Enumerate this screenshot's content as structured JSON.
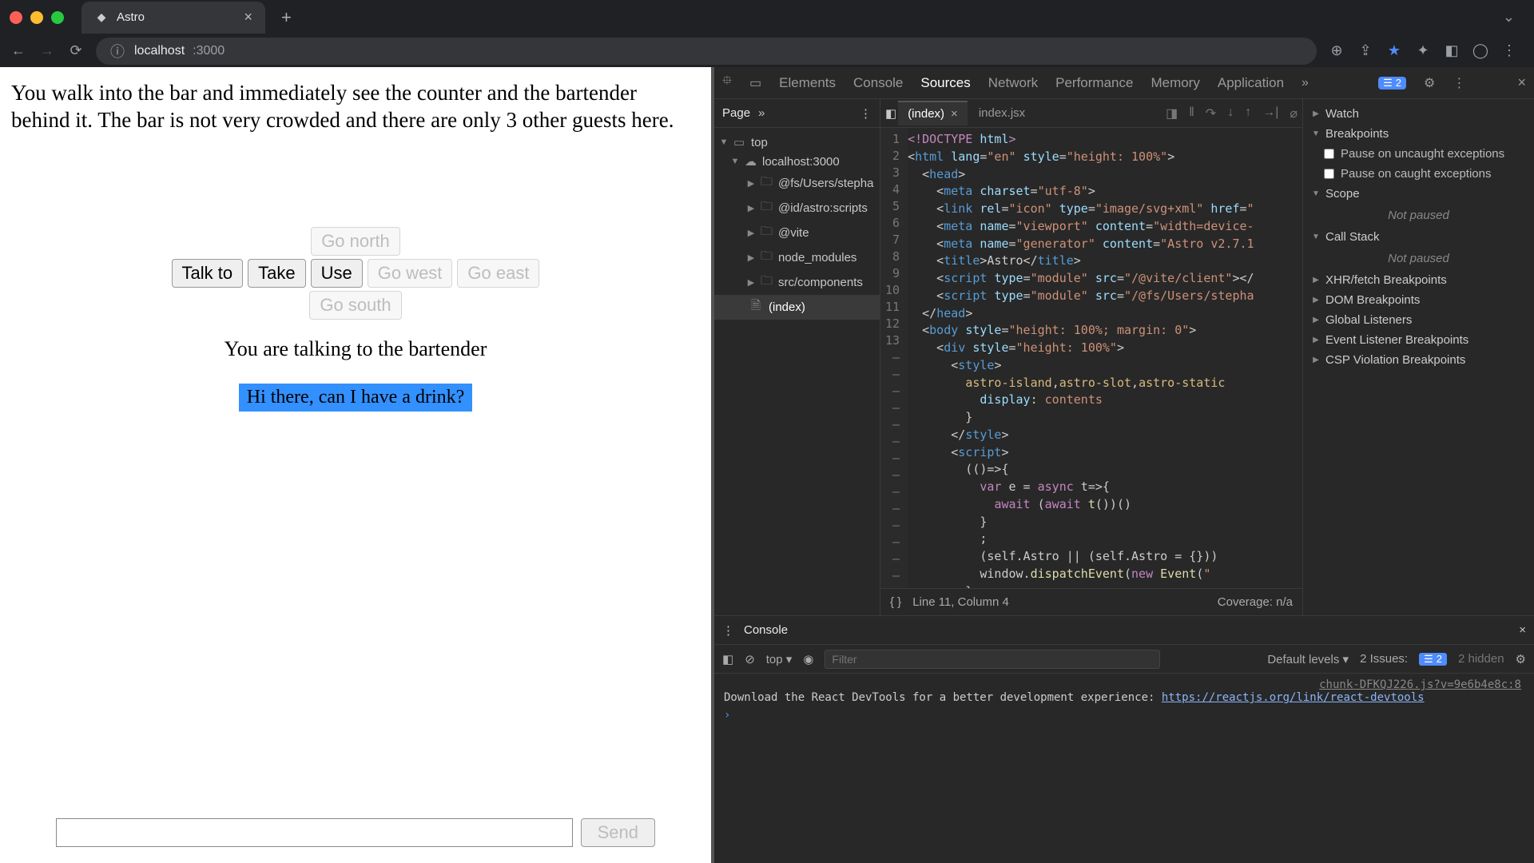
{
  "chrome": {
    "tab_title": "Astro",
    "url_domain": "localhost",
    "url_path": ":3000",
    "right_icons": [
      "zoom",
      "share",
      "star",
      "puzzle",
      "panel",
      "profile",
      "menu"
    ]
  },
  "page": {
    "narrative": "You walk into the bar and immediately see the counter and the bartender behind it. The bar is not very crowded and there are only 3 other guests here.",
    "buttons": {
      "talk": "Talk to",
      "take": "Take",
      "use": "Use",
      "north": "Go north",
      "south": "Go south",
      "east": "Go east",
      "west": "Go west"
    },
    "status": "You are talking to the bartender",
    "highlight": "Hi there, can I have a drink?",
    "send": "Send",
    "input_placeholder": ""
  },
  "devtools": {
    "tabs": [
      "Elements",
      "Console",
      "Sources",
      "Network",
      "Performance",
      "Memory",
      "Application"
    ],
    "active_tab": "Sources",
    "issue_count": "2",
    "nav_tab": "Page",
    "tree": {
      "top": "top",
      "origin": "localhost:3000",
      "folders": [
        "@fs/Users/stepha",
        "@id/astro:scripts",
        "@vite",
        "node_modules",
        "src/components"
      ],
      "file": "(index)"
    },
    "file_tabs": {
      "active": "(index)",
      "other": "index.jsx"
    },
    "gutter_nums": [
      "1",
      "2",
      "3",
      "4",
      "5",
      "6",
      "7",
      "8",
      "9",
      "10",
      "11",
      "12",
      "13",
      "—",
      "—",
      "—",
      "—",
      "—",
      "—",
      "—",
      "—",
      "—",
      "—",
      "—",
      "—",
      "—",
      "—",
      "—",
      "—",
      "—",
      "—"
    ],
    "status_line": "Line 11, Column 4",
    "coverage": "Coverage: n/a",
    "debug": {
      "watch": "Watch",
      "breakpoints": "Breakpoints",
      "pause_uncaught": "Pause on uncaught exceptions",
      "pause_caught": "Pause on caught exceptions",
      "scope": "Scope",
      "not_paused": "Not paused",
      "callstack": "Call Stack",
      "sections": [
        "XHR/fetch Breakpoints",
        "DOM Breakpoints",
        "Global Listeners",
        "Event Listener Breakpoints",
        "CSP Violation Breakpoints"
      ]
    }
  },
  "console": {
    "tab": "Console",
    "context": "top",
    "filter_placeholder": "Filter",
    "levels": "Default levels",
    "issues_label": "2 Issues:",
    "issues_count": "2",
    "hidden": "2 hidden",
    "source_ref": "chunk-DFKQJ226.js?v=9e6b4e8c:8",
    "message": "Download the React DevTools for a better development experience: ",
    "link": "https://reactjs.org/link/react-devtools"
  }
}
